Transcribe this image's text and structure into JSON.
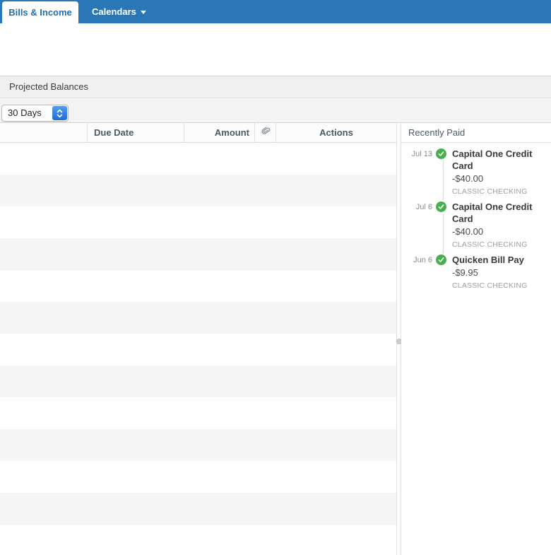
{
  "tabs": [
    {
      "label": "Bills & Income",
      "active": true
    },
    {
      "label": "Calendars",
      "active": false,
      "has_dropdown": true
    }
  ],
  "projected_balances": {
    "title": "Projected Balances"
  },
  "filters": {
    "range_select": {
      "value": "30 Days"
    }
  },
  "table": {
    "row_count": 13,
    "columns": [
      {
        "label": ""
      },
      {
        "label": "Due Date"
      },
      {
        "label": "Amount"
      },
      {
        "label": "",
        "icon": "paperclip"
      },
      {
        "label": "Actions"
      }
    ]
  },
  "recently_paid": {
    "title": "Recently Paid",
    "entries": [
      {
        "date": "Jul 13",
        "payee": "Capital One Credit Card",
        "amount": "-$40.00",
        "account": "CLASSIC CHECKING",
        "status_icon": "check-circle"
      },
      {
        "date": "Jul 6",
        "payee": "Capital One Credit Card",
        "amount": "-$40.00",
        "account": "CLASSIC CHECKING",
        "status_icon": "check-circle"
      },
      {
        "date": "Jun 6",
        "payee": "Quicken Bill Pay",
        "amount": "-$9.95",
        "account": "CLASSIC CHECKING",
        "status_icon": "check-circle"
      }
    ]
  },
  "colors": {
    "tabbar_blue": "#2a77b7",
    "active_tab_text": "#1f6fad",
    "paid_green": "#44b14a",
    "row_stripe": "#f5f5f5",
    "header_text": "#4b5a6b"
  }
}
